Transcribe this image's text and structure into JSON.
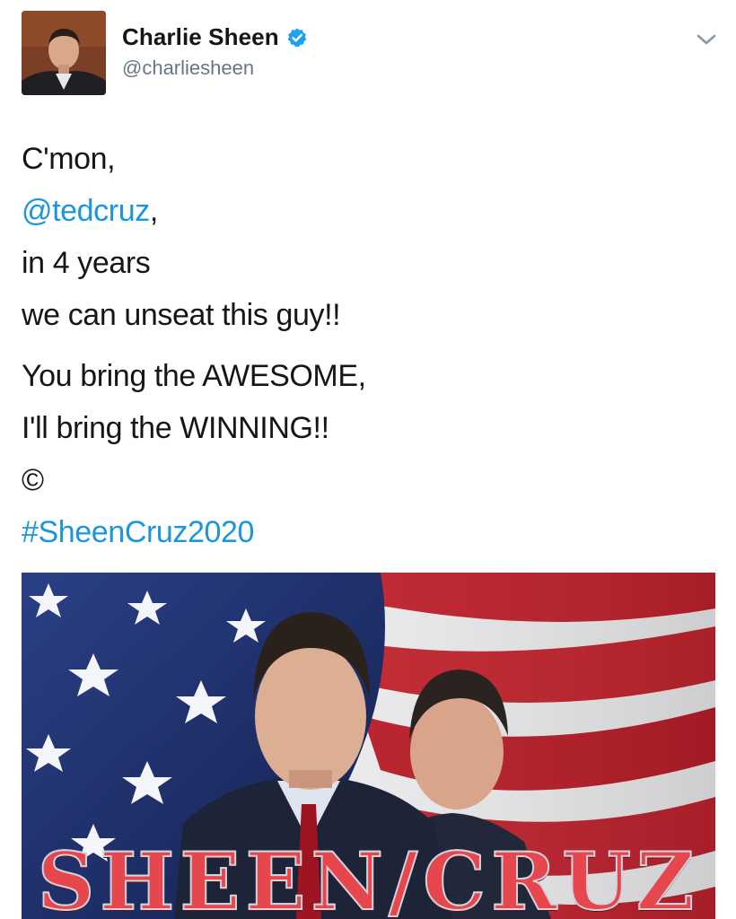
{
  "user": {
    "display_name": "Charlie Sheen",
    "handle": "@charliesheen",
    "verified": true,
    "avatar_icon": "person-avatar"
  },
  "icons": {
    "verified": "verified-badge-icon",
    "menu": "chevron-down-icon"
  },
  "colors": {
    "link": "#1b95e0",
    "verified": "#1da1f2",
    "handle": "#657786",
    "text": "#14171a"
  },
  "tweet": {
    "line1": "C'mon,",
    "mention": "@tedcruz",
    "mention_suffix": ",",
    "line3": "in 4 years",
    "line4": "we can unseat this guy!!",
    "line5": "You bring the AWESOME,",
    "line6": "I'll bring the WINNING!!",
    "line7": "©",
    "hashtag": "#SheenCruz2020"
  },
  "media": {
    "caption": "SHEEN/CRUZ",
    "description_icon": "campaign-poster-image"
  }
}
